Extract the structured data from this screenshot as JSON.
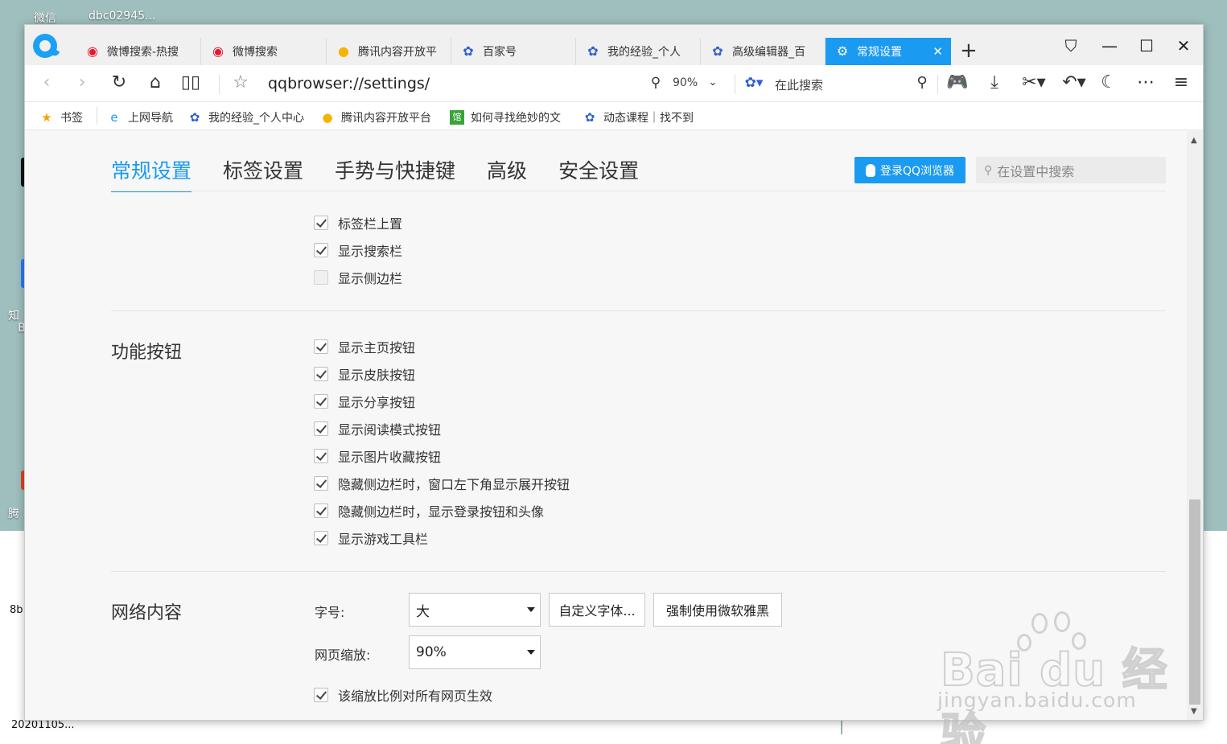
{
  "desktop": {
    "labels": [
      "微信",
      "dbc02945...",
      "知",
      "B",
      "腾",
      "8b",
      "20201105..."
    ]
  },
  "browser": {
    "tabs": [
      {
        "label": "微博搜索-热搜",
        "icon": "weibo-icon"
      },
      {
        "label": "微博搜索",
        "icon": "weibo-icon"
      },
      {
        "label": "腾讯内容开放平",
        "icon": "tencent-bell-icon"
      },
      {
        "label": "百家号",
        "icon": "baidu-paw-icon"
      },
      {
        "label": "我的经验_个人",
        "icon": "baidu-paw-icon"
      },
      {
        "label": "高级编辑器_百",
        "icon": "baidu-paw-icon"
      },
      {
        "label": "常规设置",
        "icon": "settings-icon",
        "active": true
      }
    ],
    "new_tab": "+",
    "url": "qqbrowser://settings/",
    "zoom": "90%",
    "search_placeholder": "在此搜索",
    "bookmarks": [
      {
        "label": "书签",
        "icon": "star-icon"
      },
      {
        "label": "上网导航",
        "icon": "ie-icon"
      },
      {
        "label": "我的经验_个人中心",
        "icon": "baidu-paw-icon"
      },
      {
        "label": "腾讯内容开放平台",
        "icon": "tencent-bell-icon"
      },
      {
        "label": "如何寻找绝妙的文",
        "icon": "guan-icon"
      },
      {
        "label": "动态课程｜找不到",
        "icon": "baidu-paw-icon"
      }
    ]
  },
  "settings": {
    "nav_tabs": [
      "常规设置",
      "标签设置",
      "手势与快捷键",
      "高级",
      "安全设置"
    ],
    "active_tab": "常规设置",
    "login_button": "登录QQ浏览器",
    "search_placeholder": "在设置中搜索",
    "tabbar_options": [
      {
        "label": "标签栏上置",
        "checked": true
      },
      {
        "label": "显示搜索栏",
        "checked": true
      },
      {
        "label": "显示侧边栏",
        "checked": false
      }
    ],
    "function_buttons": {
      "title": "功能按钮",
      "options": [
        {
          "label": "显示主页按钮",
          "checked": true
        },
        {
          "label": "显示皮肤按钮",
          "checked": true
        },
        {
          "label": "显示分享按钮",
          "checked": true
        },
        {
          "label": "显示阅读模式按钮",
          "checked": true
        },
        {
          "label": "显示图片收藏按钮",
          "checked": true
        },
        {
          "label": "隐藏侧边栏时，窗口左下角显示展开按钮",
          "checked": true
        },
        {
          "label": "隐藏侧边栏时，显示登录按钮和头像",
          "checked": true
        },
        {
          "label": "显示游戏工具栏",
          "checked": true
        }
      ]
    },
    "web_content": {
      "title": "网络内容",
      "font_size_label": "字号:",
      "font_size_value": "大",
      "custom_font_button": "自定义字体...",
      "force_yahei_button": "强制使用微软雅黑",
      "zoom_label": "网页缩放:",
      "zoom_value": "90%",
      "zoom_all_label": "该缩放比例对所有网页生效",
      "zoom_all_checked": true
    }
  },
  "watermark": {
    "main": "Bai du 经验",
    "sub": "jingyan.baidu.com"
  }
}
